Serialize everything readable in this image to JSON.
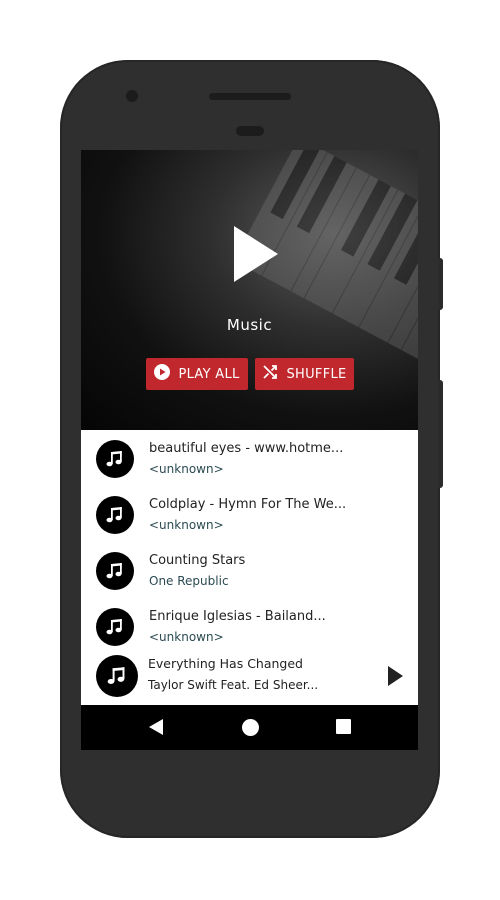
{
  "header": {
    "title": "Music",
    "play_all_label": "PLAY ALL",
    "shuffle_label": "SHUFFLE",
    "accent_color": "#c0282d"
  },
  "songs": [
    {
      "title": "beautiful eyes - www.hotme...",
      "artist": "<unknown>",
      "icon": "music-note-icon"
    },
    {
      "title": "Coldplay - Hymn For The We...",
      "artist": "<unknown>",
      "icon": "music-note-icon"
    },
    {
      "title": "Counting Stars",
      "artist": "One Republic",
      "icon": "music-note-icon"
    },
    {
      "title": "Enrique Iglesias - Bailand...",
      "artist": "<unknown>",
      "icon": "music-note-icon"
    }
  ],
  "now_playing": {
    "title": "Everything Has Changed",
    "artist": "Taylor Swift Feat. Ed Sheer...",
    "icon": "music-note-icon",
    "control_icon": "play-icon"
  },
  "navbar": {
    "icons": [
      "back-icon",
      "home-icon",
      "recents-icon"
    ]
  }
}
